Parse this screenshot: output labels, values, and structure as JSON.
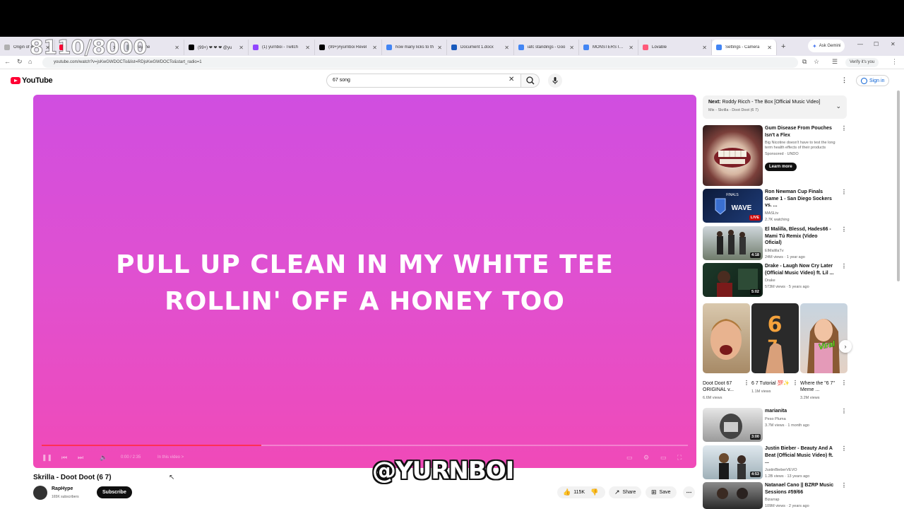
{
  "overlay": {
    "counter": "8110/8000",
    "watermark": "@YURNBOI"
  },
  "browser": {
    "tabs": [
      {
        "label": "Origin of 4/20",
        "color": "#b0b0b0"
      },
      {
        "label": "",
        "color": "#ff0033"
      },
      {
        "label": "Pay the",
        "color": "#9aa0a6"
      },
      {
        "label": "(99+) ❤ ❤ ❤ @yu",
        "color": "#000000"
      },
      {
        "label": "(1) yurnboi - Twitch",
        "color": "#9146ff"
      },
      {
        "label": "(99+)#yurnboi Revel",
        "color": "#000000"
      },
      {
        "label": "how many licks to th",
        "color": "#4285f4"
      },
      {
        "label": "Document 1.docx",
        "color": "#185abd"
      },
      {
        "label": "iafc standings - Goo",
        "color": "#4285f4"
      },
      {
        "label": "MONSTERS INC - G",
        "color": "#4285f4"
      },
      {
        "label": "Lovable",
        "color": "#ff5a7a"
      },
      {
        "label": "Settings - Camera",
        "color": "#4285f4"
      }
    ],
    "new_tab": "+",
    "gemini": "Ask Gemini",
    "url": "youtube.com/watch?v=jsKwGWDOCTo&list=RDjsKwGWDOCTo&start_radio=1",
    "verify": "Verify it's you"
  },
  "youtube": {
    "logo": "YouTube",
    "search_value": "67 song",
    "signin": "Sign in"
  },
  "player": {
    "lyric_line1": "PULL UP CLEAN IN MY WHITE TEE",
    "lyric_line2": "ROLLIN' OFF A HONEY TOO",
    "time": "0:00 / 2:35",
    "chapter": "In this video >",
    "progress_fraction": 0.34
  },
  "video": {
    "title": "Skrilla - Doot Doot (6 7)",
    "channel": "RapHype",
    "subscribers": "165K subscribers",
    "subscribe": "Subscribe",
    "likes": "115K",
    "share": "Share",
    "save": "Save"
  },
  "up_next": {
    "label": "Next:",
    "title": "Roddy Ricch - The Box [Official Music Video]",
    "mix": "Mix - Skrilla - Doot Doot (6 7)"
  },
  "recommendations": [
    {
      "title": "Gum Disease From Pouches Isn't a Flex",
      "channel": "Big Nicotine doesn't have to test the long term health effects of their products",
      "stats": "Sponsored · UNDO",
      "cta": "Learn more",
      "badge": ""
    },
    {
      "title": "Ron Newman Cup Finals Game 1 - San Diego Sockers vs. ...",
      "channel": "MASLtv",
      "stats": "2.7K watching",
      "badge": "LIVE"
    },
    {
      "title": "El Malilla, Blessd, Hades66 - Mami Tú Remix (Video Oficial)",
      "channel": "ElMalillaTv",
      "stats": "24M views · 1 year ago",
      "badge": "4:18"
    },
    {
      "title": "Drake - Laugh Now Cry Later (Official Music Video) ft. Lil ...",
      "channel": "Drake",
      "stats": "573M views · 5 years ago",
      "badge": "5:02"
    }
  ],
  "shorts": [
    {
      "title": "Doot Doot 67 ORIGINAL v...",
      "stats": "6.6M views"
    },
    {
      "title": "6 7 Tutorial 💯✨",
      "stats": "1.1M views"
    },
    {
      "title": "Where the \"6 7\" Meme ...",
      "stats": "3.2M views"
    }
  ],
  "shorts_overlay": "Viral",
  "recommendations2": [
    {
      "title": "marianita",
      "channel": "Peso Pluma",
      "stats": "3.7M views · 1 month ago",
      "badge": "3:00"
    },
    {
      "title": "Justin Bieber - Beauty And A Beat (Official Music Video) ft. ...",
      "channel": "JustinBieberVEVO",
      "stats": "1.2B views · 13 years ago",
      "badge": "4:53"
    },
    {
      "title": "Natanael Cano || BZRP Music Sessions #59/66",
      "channel": "Bizarrap",
      "stats": "109M views · 2 years ago",
      "badge": ""
    }
  ]
}
